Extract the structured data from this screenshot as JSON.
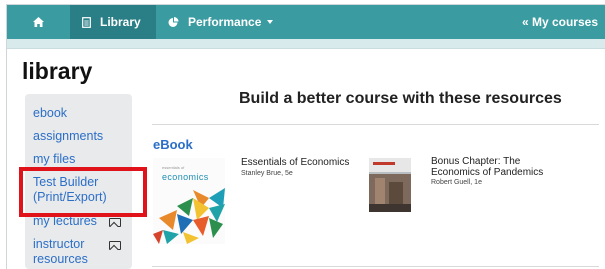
{
  "nav": {
    "home_icon": "home-icon",
    "library_label": "Library",
    "library_icon": "document-icon",
    "performance_label": "Performance",
    "performance_icon": "pie-chart-icon",
    "my_courses_label": "« My courses"
  },
  "page": {
    "title": "library"
  },
  "sidebar": {
    "items": [
      {
        "label": "ebook"
      },
      {
        "label": "assignments"
      },
      {
        "label": "my files"
      },
      {
        "label": "Test Builder (Print/Export)"
      },
      {
        "label": "my lectures",
        "icon": "external-window-icon"
      },
      {
        "label": "instructor resources",
        "icon": "external-window-icon"
      }
    ]
  },
  "main": {
    "headline": "Build a better course with these resources",
    "section_label": "eBook",
    "books": [
      {
        "title": "Essentials of Economics",
        "author": "Stanley Brue, 5e",
        "cover_text": "economics",
        "cover_sup": "essentials of"
      },
      {
        "title": "Bonus Chapter: The Economics of Pandemics",
        "author": "Robert Guell, 1e"
      }
    ]
  },
  "colors": {
    "nav_bg": "#3a9ba1",
    "nav_active_bg": "#2a7f86",
    "link": "#2b6fc7",
    "highlight_border": "#e0131a",
    "sidebar_bg": "#e9eaec"
  }
}
